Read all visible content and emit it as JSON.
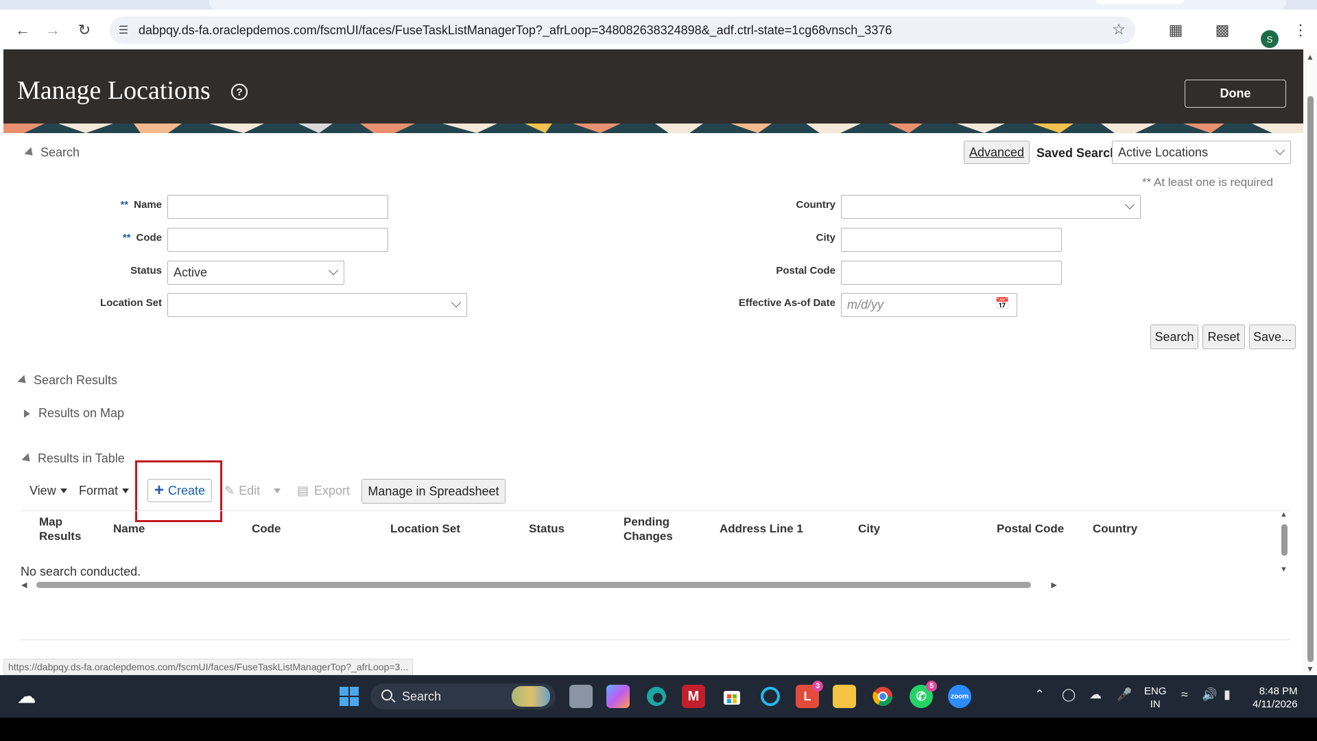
{
  "browser": {
    "url": "dabpqy.ds-fa.oraclepdemos.com/fscmUI/faces/FuseTaskListManagerTop?_afrLoop=348082638324898&_adf.ctrl-state=1cg68vnsch_3376",
    "profile_initial": "S",
    "status_url": "https://dabpqy.ds-fa.oraclepdemos.com/fscmUI/faces/FuseTaskListManagerTop?_afrLoop=3..."
  },
  "header": {
    "title": "Manage Locations",
    "done_label": "Done"
  },
  "search": {
    "section_label": "Search",
    "advanced_label": "Advanced",
    "saved_search_label": "Saved Search",
    "saved_search_value": "Active Locations",
    "required_note": "** At least one is required",
    "required_mark": "**",
    "fields": {
      "name_label": "Name",
      "code_label": "Code",
      "status_label": "Status",
      "status_value": "Active",
      "location_set_label": "Location Set",
      "country_label": "Country",
      "city_label": "City",
      "postal_code_label": "Postal Code",
      "effective_date_label": "Effective As-of Date",
      "effective_date_placeholder": "m/d/yy"
    },
    "search_btn": "Search",
    "reset_btn": "Reset",
    "save_btn": "Save..."
  },
  "results": {
    "section_label": "Search Results",
    "map_label": "Results on Map",
    "table_label": "Results in Table",
    "toolbar": {
      "view": "View",
      "format": "Format",
      "create": "Create",
      "edit": "Edit",
      "export": "Export",
      "spreadsheet": "Manage in Spreadsheet"
    },
    "columns": [
      "Map Results",
      "Name",
      "Code",
      "Location Set",
      "Status",
      "Pending Changes",
      "Address Line 1",
      "City",
      "Postal Code",
      "Country"
    ],
    "empty_text": "No search conducted."
  },
  "taskbar": {
    "search_label": "Search",
    "lang_top": "ENG",
    "lang_bottom": "IN",
    "time": "8:48 PM",
    "date": "4/11/2026",
    "badge_l": "3",
    "badge_whatsapp": "5"
  },
  "colors": {
    "header_bg": "#312d2a",
    "highlight_box": "#c0161d",
    "link_blue": "#1a5fa8"
  }
}
